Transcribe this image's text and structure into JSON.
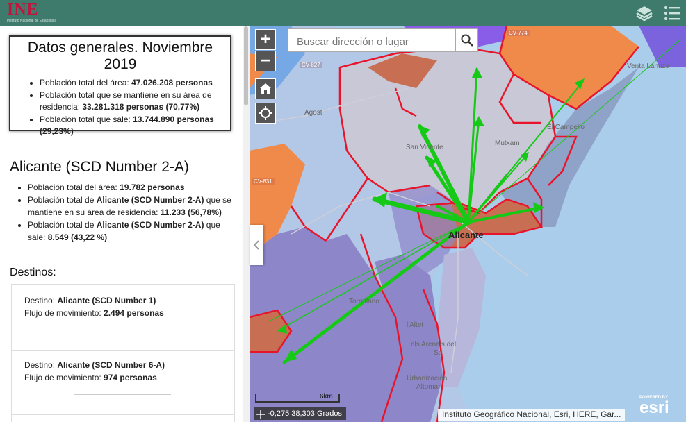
{
  "header": {
    "logo_text": "INE",
    "logo_subtitle": "Instituto Nacional de Estadística",
    "layers_icon": "layers-icon",
    "list_icon": "list-icon"
  },
  "summary": {
    "title": "Datos generales. Noviembre 2019",
    "items": [
      {
        "label": "Población total del área: ",
        "value": "47.026.208 personas"
      },
      {
        "label": "Población total que se mantiene en su área de residencia: ",
        "value": "33.281.318 personas (70,77%)"
      },
      {
        "label": "Población total que sale: ",
        "value": "13.744.890 personas (29,23%)"
      }
    ]
  },
  "area": {
    "title": "Alicante (SCD Number 2-A)",
    "item1_label": "Población total del área: ",
    "item1_value": "19.782 personas",
    "item2_label1": "Población total de ",
    "item2_place": "Alicante (SCD Number 2-A)",
    "item2_label2": " que se mantiene en su área de residencia: ",
    "item2_value": "11.233 (56,78%)",
    "item3_label1": "Población total de ",
    "item3_place": "Alicante (SCD Number 2-A)",
    "item3_label2": " que sale: ",
    "item3_value": "8.549 (43,22 %)"
  },
  "destinations": {
    "title": "Destinos:",
    "dest_label": "Destino: ",
    "flow_label": "Flujo de movimiento: ",
    "items": [
      {
        "name": "Alicante (SCD Number 1)",
        "flow": "2.494 personas"
      },
      {
        "name": "Alicante (SCD Number 6-A)",
        "flow": "974 personas"
      }
    ]
  },
  "map": {
    "search_placeholder": "Buscar dirección o lugar",
    "zoom_in": "+",
    "zoom_out": "−",
    "coords": "-0,275 38,303 Grados",
    "attribution": "Instituto Geográfico Nacional, Esri, HERE, Gar...",
    "scale_label": "6km",
    "esri_small": "POWERED BY",
    "esri_big": "esri",
    "labels": {
      "alicante": "Alicante",
      "agost": "Agost",
      "san_vicente": "San Vicente",
      "el_campello": "El Campello",
      "mutxamel": "Mutxam",
      "venta_lanuza": "Venta Lanuza",
      "torrellano": "Torrellano",
      "altet": "l'Altet",
      "arenals": "els Arenals del",
      "sol": "Sol",
      "urbanizacion": "Urbanización",
      "altomar": "Altomar",
      "cv827": "CV-827",
      "cv831": "CV-831",
      "cv774": "CV-774"
    }
  },
  "colors": {
    "header_bg": "#3f7b6c",
    "logo": "#c0163e",
    "flow_arrow": "#17c917",
    "boundary": "#e8152a"
  }
}
